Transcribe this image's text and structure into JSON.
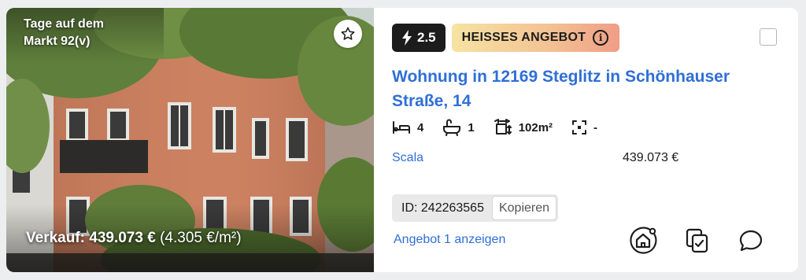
{
  "listing": {
    "market_days_line1": "Tage auf dem",
    "market_days_line2": "Markt 92(v)",
    "sale_label": "Verkauf: 439.073 €",
    "sale_per_sqm": "(4.305 €/m²)",
    "score": "2.5",
    "hot_label": "HEISSES ANGEBOT",
    "info_glyph": "i",
    "title": "Wohnung in 12169 Steglitz in Schönhauser Straße, 14",
    "features": {
      "bedrooms": "4",
      "bathrooms": "1",
      "area": "102m²",
      "extra": "-"
    },
    "agent": "Scala",
    "price": "439.073 €",
    "id_text": "ID: 242263565",
    "copy_label": "Kopieren",
    "show_offer_label": "Angebot 1 anzeigen"
  },
  "icons": {
    "favorite": "star-icon",
    "score": "lightning-icon",
    "info": "info-icon",
    "bed": "bed-icon",
    "bath": "bathtub-icon",
    "area": "area-icon",
    "extra": "dashed-square-icon",
    "house": "house-notification-icon",
    "copy": "copy-check-icon",
    "chat": "chat-bubble-icon"
  },
  "colors": {
    "link_blue": "#2f6fd6",
    "score_bg": "#1c1c1c",
    "hot_gradient_start": "#f6e3a2",
    "hot_gradient_end": "#ef9e86"
  }
}
